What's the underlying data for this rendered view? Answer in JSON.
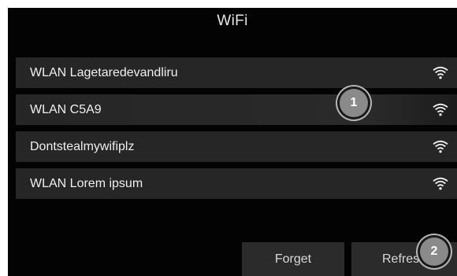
{
  "title": "WiFi",
  "networks": [
    {
      "name": "WLAN Lagetaredevandliru",
      "signal_icon": "wifi-full-icon"
    },
    {
      "name": "WLAN C5A9",
      "signal_icon": "wifi-full-icon"
    },
    {
      "name": "Dontstealmywifiplz",
      "signal_icon": "wifi-full-icon"
    },
    {
      "name": "WLAN Lorem ipsum",
      "signal_icon": "wifi-full-icon"
    }
  ],
  "buttons": {
    "forget_label": "Forget",
    "refresh_label": "Refresh"
  },
  "markers": {
    "first": "1",
    "second": "2"
  },
  "colors": {
    "background": "#030303",
    "row": "#262626",
    "button": "#2b2b2b",
    "marker": "#8a8a8a"
  }
}
